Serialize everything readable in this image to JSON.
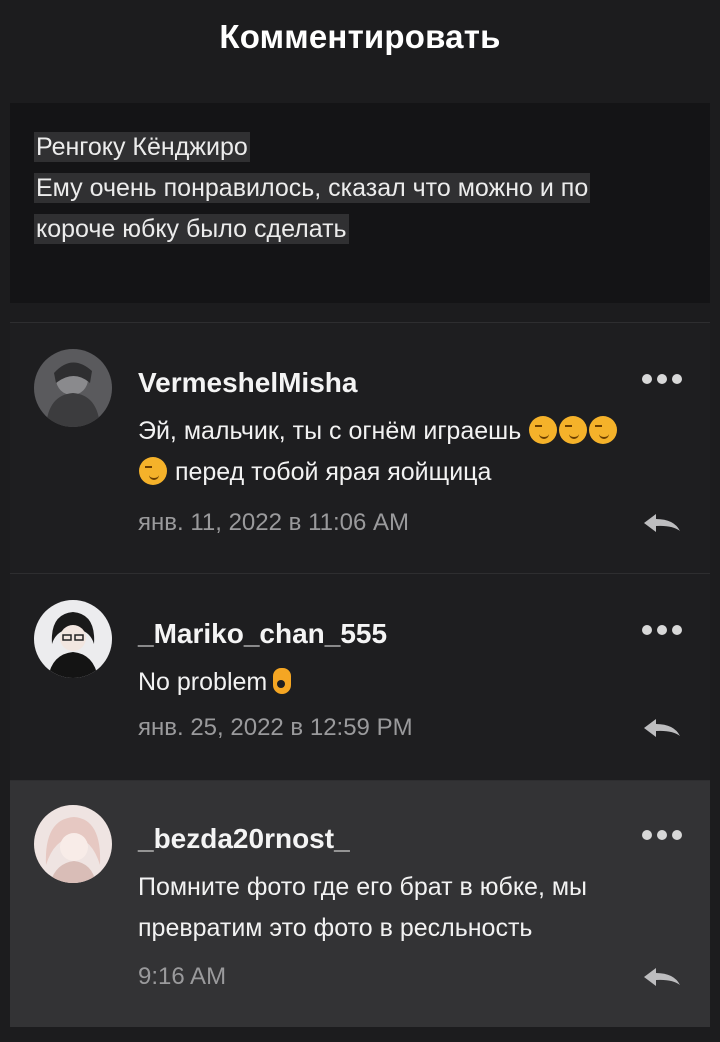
{
  "header": {
    "title": "Комментировать"
  },
  "quoted_comment": {
    "author": "Ренгоку Кёнджиро",
    "line1": "Ему очень понравилось, сказал что можно и по",
    "line2": "короче юбку было сделать"
  },
  "comments": [
    {
      "username": "VermeshelMisha",
      "text_line1": "Эй, мальчик, ты с огнём играешь",
      "text_line2": "перед тобой ярая яойщица",
      "emoji": "smirking-face-emoji",
      "date": "янв. 11, 2022 в 11:06 AM",
      "avatar_color": "#6d6d70"
    },
    {
      "username": "_Mariko_chan_555",
      "text_line1": "No problem",
      "emoji": "ok-hand-emoji",
      "date": "янв. 25, 2022 в 12:59 PM",
      "avatar_color": "#e9e9eb"
    },
    {
      "username": "_bezda20rnost_",
      "text_line1": "Помните фото где его брат в юбке, мы",
      "text_line2": "превратим это фото в ресльность",
      "date": "9:16 AM",
      "avatar_color": "#eadbd8",
      "highlighted": true
    }
  ],
  "icons": {
    "more": "more-dots-icon",
    "reply": "reply-arrow-icon"
  },
  "colors": {
    "background": "#1c1c1e",
    "highlight": "#333335",
    "date_text": "#9a9a9c"
  }
}
